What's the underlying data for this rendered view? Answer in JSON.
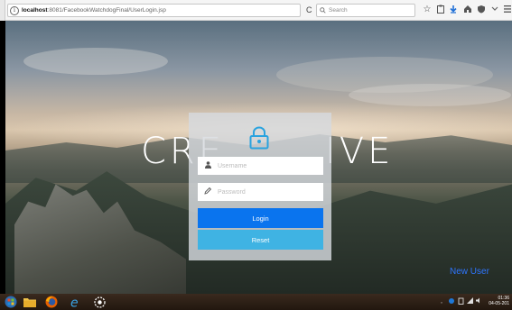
{
  "browser": {
    "url_host": "localhost",
    "url_path": ":8081/FacebookWatchdogFinal/UserLogin.jsp",
    "search_placeholder": "Search",
    "info_symbol": "i",
    "reload_symbol": "C"
  },
  "page": {
    "brand_left": "CRE",
    "brand_right": "IVE",
    "username_placeholder": "Username",
    "password_placeholder": "Password",
    "login_label": "Login",
    "reset_label": "Reset",
    "new_user_label": "New User",
    "accent_login": "#0a74ee",
    "accent_reset": "#3fb3e3"
  },
  "taskbar": {
    "time": "01:36",
    "date": "04-05-201"
  },
  "icons": [
    "info-icon",
    "reload-icon",
    "search-icon",
    "star-icon",
    "clipboard-icon",
    "download-icon",
    "home-icon",
    "shield-icon",
    "overflow-icon",
    "menu-icon",
    "lock-icon",
    "user-icon",
    "pencil-icon",
    "start-icon",
    "folder-icon",
    "firefox-icon",
    "ie-icon",
    "settings-icon"
  ]
}
